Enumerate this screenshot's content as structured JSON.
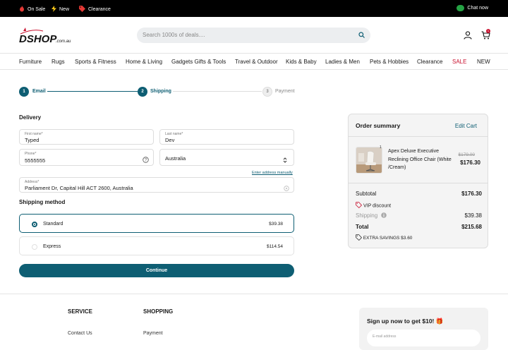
{
  "topbar": {
    "promos": [
      {
        "label": "On Sale",
        "icon": "fire-icon"
      },
      {
        "label": "New",
        "icon": "lightning-icon"
      },
      {
        "label": "Clearance",
        "icon": "tag-icon"
      }
    ],
    "chat_label": "Chat now"
  },
  "header": {
    "logo_text": "DSHOP",
    "logo_suffix": ".com.au",
    "search_placeholder": "Search 1000s of deals....",
    "cart_count": "1"
  },
  "nav": {
    "items": [
      "Furniture",
      "Rugs",
      "Sports & Fitness",
      "Home & Living",
      "Gadgets Gifts & Tools",
      "Travel & Outdoor",
      "Kids & Baby",
      "Ladies & Men",
      "Pets & Hobbies",
      "Clearance",
      "SALE",
      "NEW"
    ]
  },
  "steps": [
    {
      "num": "1",
      "label": "Email"
    },
    {
      "num": "2",
      "label": "Shipping"
    },
    {
      "num": "3",
      "label": "Payment"
    }
  ],
  "delivery": {
    "title": "Delivery",
    "first_name_label": "First name*",
    "first_name": "Typed",
    "last_name_label": "Last name*",
    "last_name": "Dev",
    "phone_label": "Phone*",
    "phone": "5555555",
    "country": "Australia",
    "enter_manually": "Enter address manually",
    "address_label": "Address*",
    "address": "Parliament Dr, Capital Hill ACT 2600, Australia"
  },
  "shipping": {
    "title": "Shipping method",
    "options": [
      {
        "name": "Standard",
        "price": "$39.38",
        "selected": true
      },
      {
        "name": "Express",
        "price": "$114.54",
        "selected": false
      }
    ]
  },
  "continue_label": "Continue",
  "summary": {
    "title": "Order summary",
    "edit_label": "Edit Cart",
    "product": {
      "qty": "1",
      "name": "Apex Deluxe Executive Reclining Office Chair (White /Cream)",
      "old_price": "$179.00",
      "price": "$176.30"
    },
    "subtotal_label": "Subtotal",
    "subtotal": "$176.30",
    "vip_label": "VIP discount",
    "shipping_label": "Shipping",
    "shipping": "$39.38",
    "total_label": "Total",
    "total": "$215.68",
    "savings": "EXTRA SAVINGS $3.60"
  },
  "footer": {
    "service_title": "SERVICE",
    "service_link": "Contact Us",
    "shopping_title": "SHOPPING",
    "shopping_link": "Payment",
    "signup_title": "Sign up now to get $10! 🎁",
    "email_placeholder": "E-mail address"
  },
  "colors": {
    "accent": "#0e5e73",
    "sale": "#c8102e",
    "chat": "#25a244"
  }
}
